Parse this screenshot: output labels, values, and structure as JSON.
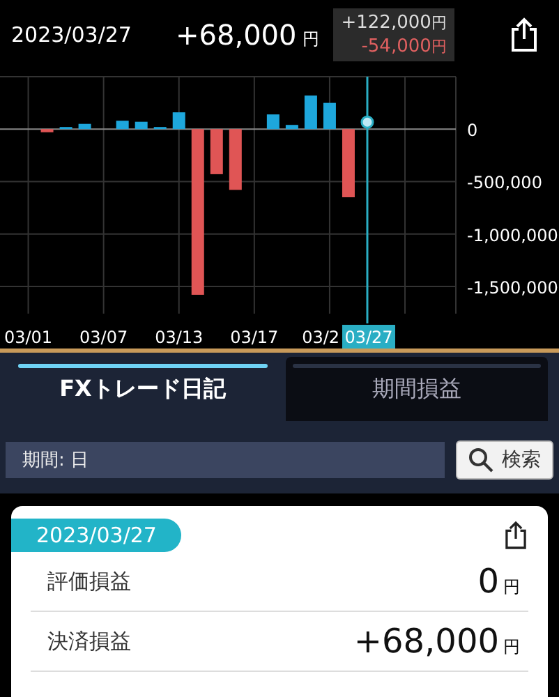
{
  "header": {
    "date": "2023/03/27",
    "total": "+68,000",
    "total_unit": "円",
    "tooltip": [
      {
        "kind": "gain",
        "value": "+122,000",
        "unit": "円"
      },
      {
        "kind": "loss",
        "value": "-54,000",
        "unit": "円"
      }
    ]
  },
  "chart_data": {
    "type": "bar",
    "grid": true,
    "categories": [
      "03/01",
      null,
      null,
      null,
      "03/07",
      null,
      null,
      null,
      "03/13",
      null,
      null,
      null,
      "03/17",
      null,
      null,
      null,
      "03/2",
      null,
      "03/27",
      null,
      null,
      null,
      null
    ],
    "values": [
      null,
      -30000,
      20000,
      50000,
      null,
      80000,
      70000,
      20000,
      160000,
      -1580000,
      -430000,
      -580000,
      null,
      140000,
      40000,
      320000,
      250000,
      -650000,
      null,
      null,
      null,
      null,
      null
    ],
    "yticks": [
      {
        "value": 0,
        "label": "0"
      },
      {
        "value": -500000,
        "label": "-500,000"
      },
      {
        "value": -1000000,
        "label": "-1,000,000"
      },
      {
        "value": -1500000,
        "label": "-1,500,000"
      }
    ],
    "ylim": [
      -1760000,
      500000
    ]
  },
  "tabs": [
    {
      "label": "FXトレード日記",
      "selected": true
    },
    {
      "label": "期間損益",
      "selected": false
    }
  ],
  "period_field": {
    "value": "期間: 日"
  },
  "search_button": {
    "label": "検索"
  },
  "card": {
    "date": "2023/03/27",
    "rows": [
      {
        "label": "評価損益",
        "value": "0",
        "unit": "円"
      },
      {
        "label": "決済損益",
        "value": "+68,000",
        "unit": "円"
      }
    ]
  }
}
